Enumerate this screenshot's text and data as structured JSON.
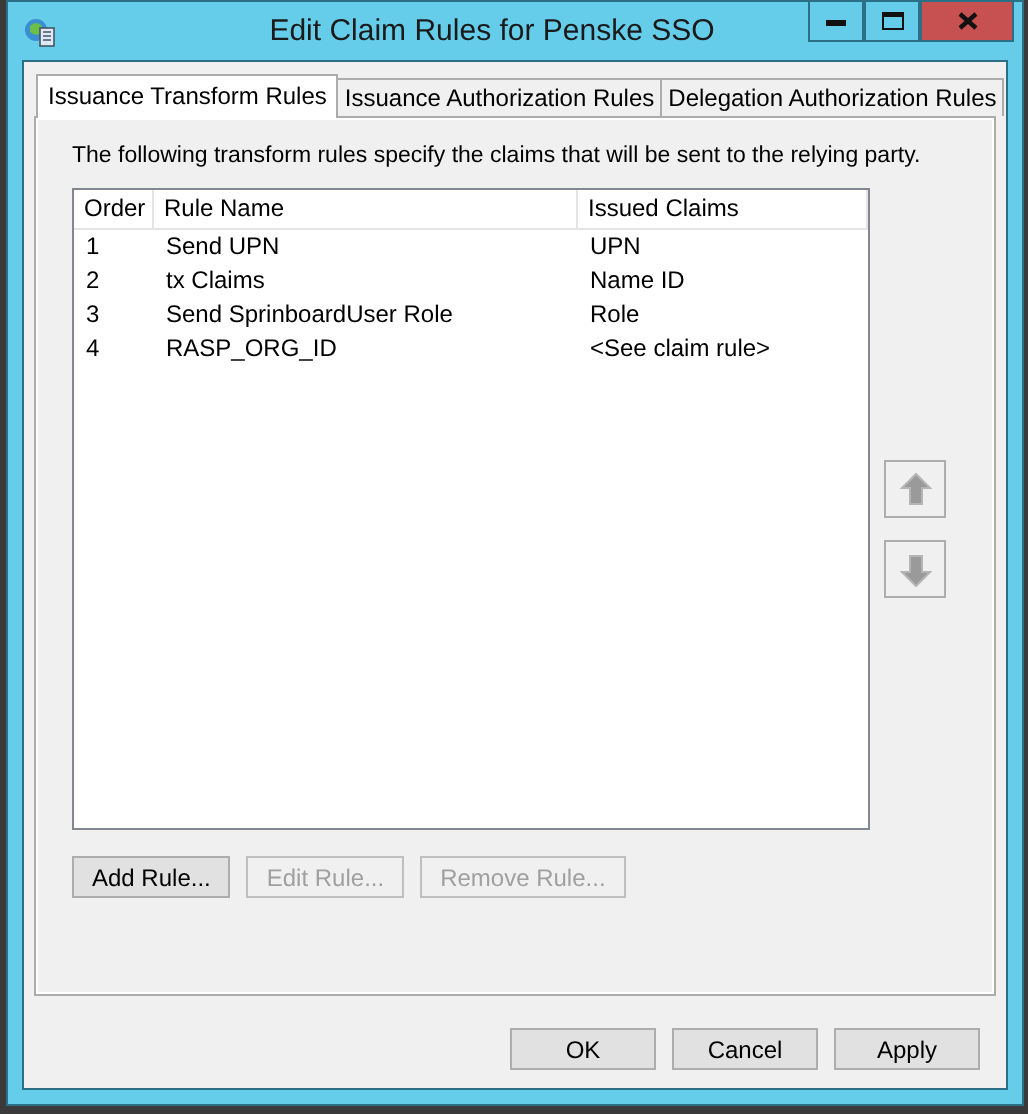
{
  "window": {
    "title": "Edit Claim Rules for Penske SSO"
  },
  "tabs": [
    {
      "label": "Issuance Transform Rules",
      "selected": true
    },
    {
      "label": "Issuance Authorization Rules",
      "selected": false
    },
    {
      "label": "Delegation Authorization Rules",
      "selected": false
    }
  ],
  "description": "The following transform rules specify the claims that will be sent to the relying party.",
  "table": {
    "columns": [
      "Order",
      "Rule Name",
      "Issued Claims"
    ],
    "rows": [
      [
        "1",
        "Send UPN",
        "UPN"
      ],
      [
        "2",
        "tx Claims",
        "Name ID"
      ],
      [
        "3",
        "Send SprinboardUser Role",
        "Role"
      ],
      [
        "4",
        "RASP_ORG_ID",
        "<See claim rule>"
      ]
    ]
  },
  "move_buttons": [
    {
      "kind": "up",
      "disabled": true
    },
    {
      "kind": "down",
      "disabled": true
    }
  ],
  "rule_buttons": [
    {
      "label": "Add Rule...",
      "disabled": false
    },
    {
      "label": "Edit Rule...",
      "disabled": true
    },
    {
      "label": "Remove Rule...",
      "disabled": true
    }
  ],
  "dialog_buttons": [
    "OK",
    "Cancel",
    "Apply"
  ]
}
